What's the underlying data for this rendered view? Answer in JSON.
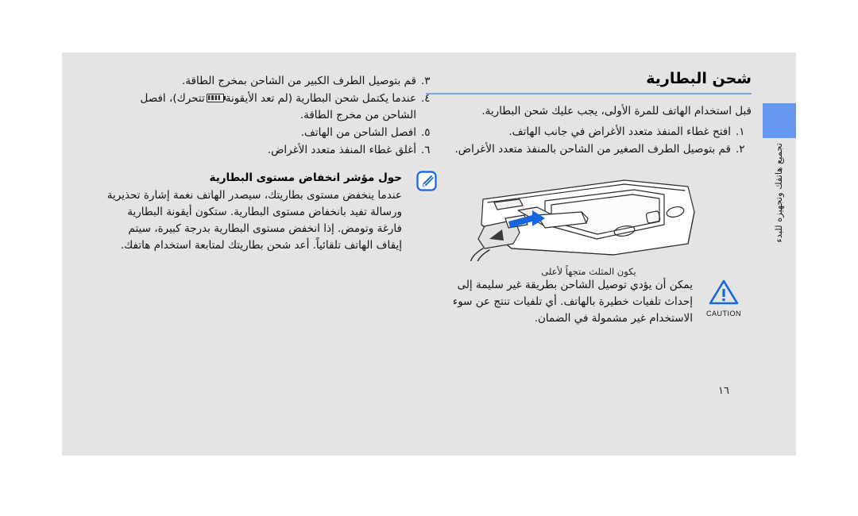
{
  "document": {
    "page_number": "١٦",
    "side_tab_label": "تجميع هاتفك وتجهيزه للبدء",
    "accent_color": "#6699f0",
    "rule_color": "#7aa6e8",
    "page_background": "#e4e4e4"
  },
  "section": {
    "title": "شحن البطارية",
    "intro": "قبل استخدام الهاتف للمرة الأولى، يجب عليك شحن البطارية."
  },
  "steps": [
    {
      "num": "١.",
      "text": "افتح غطاء المنفذ متعدد الأغراض في جانب الهاتف."
    },
    {
      "num": "٢.",
      "text": "قم بتوصيل الطرف الصغير من الشاحن بالمنفذ متعدد الأغراض."
    },
    {
      "num": "٣.",
      "text": "قم بتوصيل الطرف الكبير من الشاحن بمخرج الطاقة."
    },
    {
      "num": "٤.",
      "text_before": "عندما يكتمل شحن البطارية (لم تعد الأيقونة",
      "icon": "battery-icon",
      "text_after": "تتحرك)، افصل الشاحن من مخرج الطاقة."
    },
    {
      "num": "٥.",
      "text": "افصل الشاحن من الهاتف."
    },
    {
      "num": "٦.",
      "text": "أغلق غطاء المنفذ متعدد الأغراض."
    }
  ],
  "note": {
    "icon": "note-pen-icon",
    "title": "حول مؤشر انخفاض مستوى البطارية",
    "body": "عندما ينخفض مستوى بطاريتك، سيصدر الهاتف نغمة إشارة تحذيرية ورسالة تفيد بانخفاض مستوى البطارية. ستكون أيقونة البطارية فارغة وتومض. إذا انخفض مستوى البطارية بدرجة كبيرة، سيتم إيقاف الهاتف تلقائياً. أعد شحن بطاريتك لمتابعة استخدام هاتفك."
  },
  "figure": {
    "caption": "يكون المثلث متجهاً لأعلى",
    "alt_name": "phone-charger-connection-illustration",
    "arrow_color": "#1565e0"
  },
  "caution": {
    "icon": "caution-triangle-icon",
    "icon_label": "CAUTION",
    "body": "يمكن أن يؤدي توصيل الشاحن بطريقة غير سليمة إلى إحداث تلفيات خطيرة بالهاتف. أي تلفيات تنتج عن سوء الاستخدام غير مشمولة في الضمان."
  }
}
